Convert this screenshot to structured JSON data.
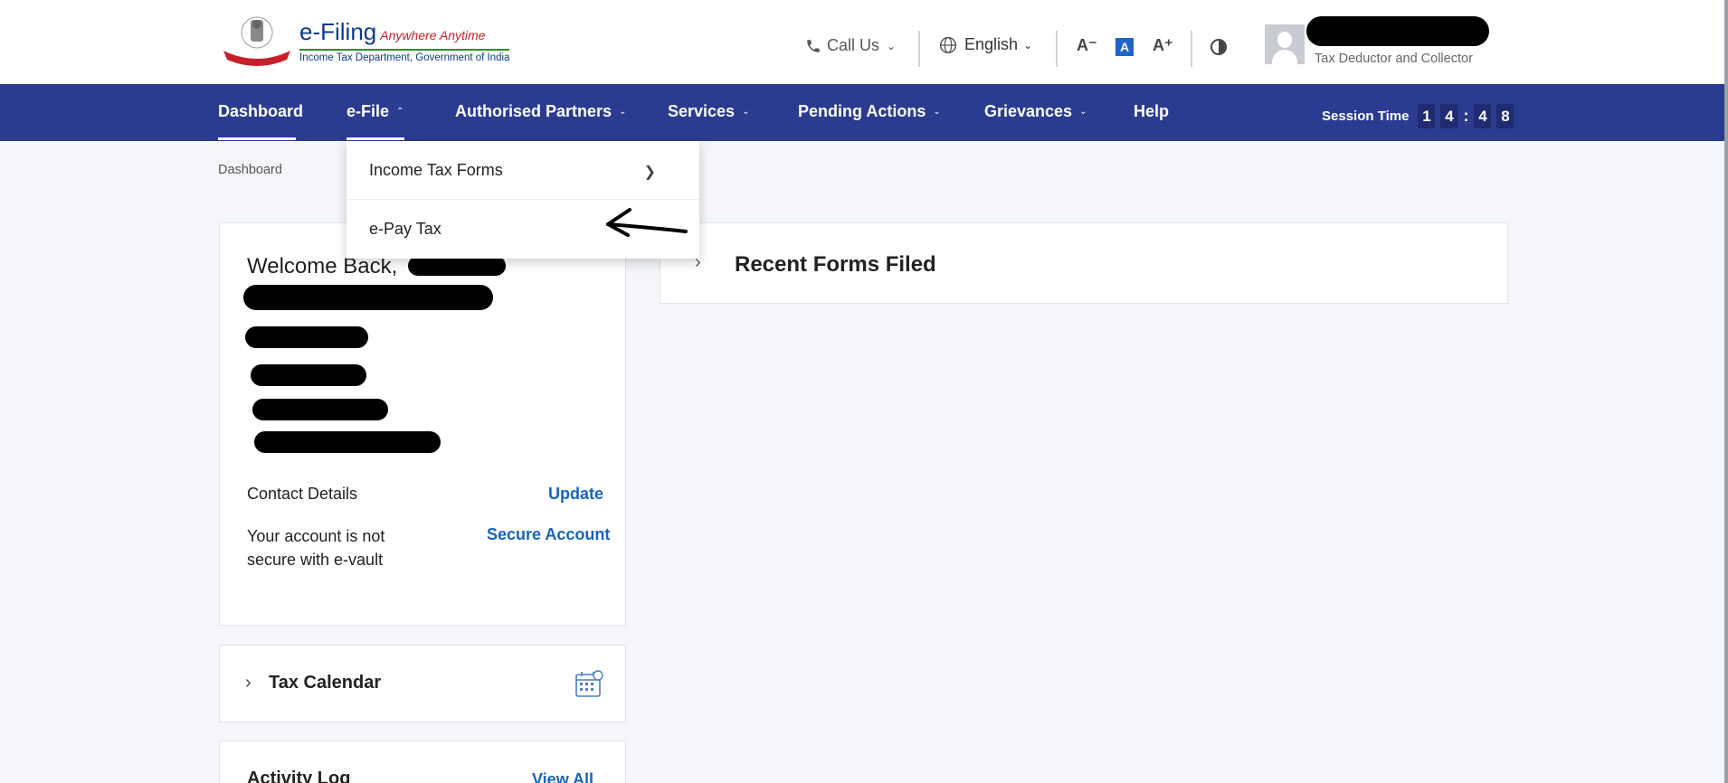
{
  "header": {
    "logo": {
      "title": "e-Filing",
      "tagline": "Anywhere Anytime",
      "subtitle": "Income Tax Department, Government of India",
      "emblem_text": "INCOME TAX DEPARTMENT"
    },
    "call_us": "Call Us",
    "language": "English",
    "font_decrease": "A⁻",
    "font_normal": "A",
    "font_increase": "A⁺",
    "user_role": "Tax Deductor and Collector"
  },
  "nav": {
    "items": [
      {
        "label": "Dashboard"
      },
      {
        "label": "e-File"
      },
      {
        "label": "Authorised Partners"
      },
      {
        "label": "Services"
      },
      {
        "label": "Pending Actions"
      },
      {
        "label": "Grievances"
      },
      {
        "label": "Help"
      }
    ],
    "session_label": "Session Time",
    "session_digits": [
      "1",
      "4",
      "4",
      "8"
    ]
  },
  "dropdown": {
    "items": [
      {
        "label": "Income Tax Forms"
      },
      {
        "label": "e-Pay Tax"
      }
    ]
  },
  "breadcrumb": "Dashboard",
  "welcome": {
    "greeting": "Welcome Back,",
    "contact_label": "Contact Details",
    "update_link": "Update",
    "secure_text": "Your account is not secure with e-vault",
    "secure_link": "Secure Account"
  },
  "tax_calendar": {
    "title": "Tax Calendar"
  },
  "activity_log": {
    "title": "Activity Log",
    "link": "View All"
  },
  "recent_forms": {
    "title": "Recent Forms Filed"
  },
  "colors": {
    "nav_bg": "#2b3b8f",
    "link": "#1565c0",
    "page_bg": "#f4f6fb"
  }
}
